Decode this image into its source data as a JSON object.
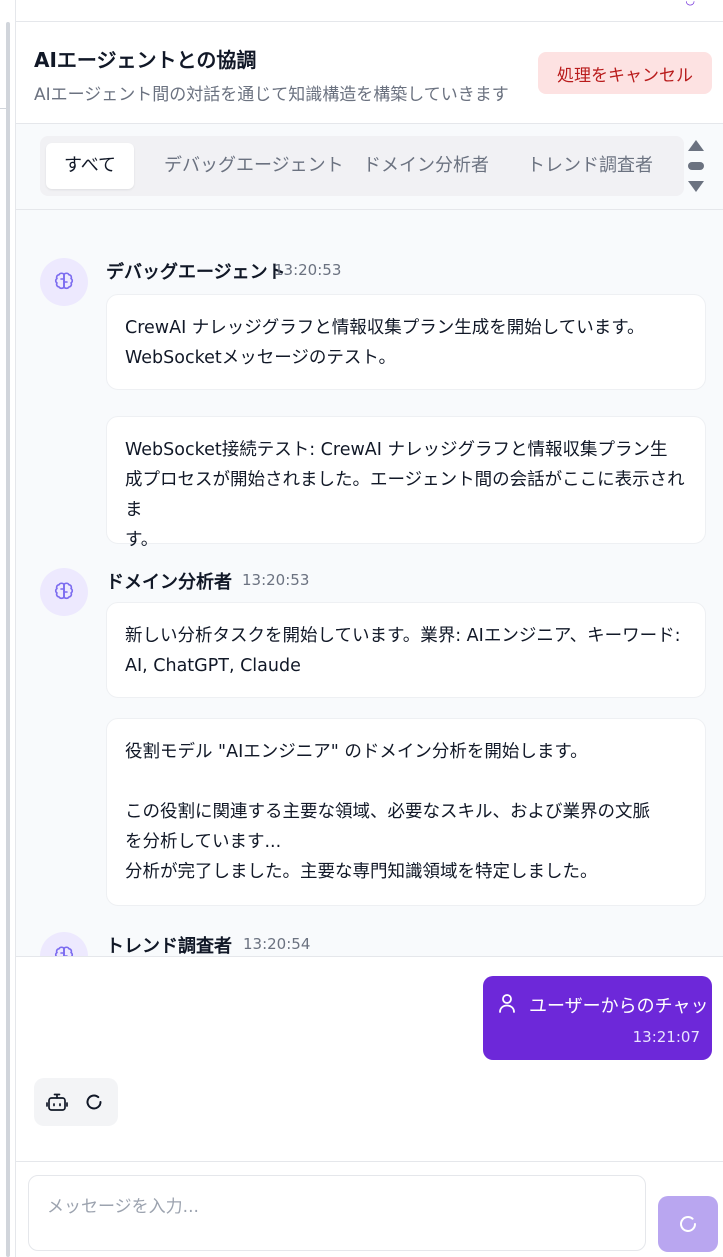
{
  "header": {
    "title": "AIエージェントとの協調",
    "subtitle": "AIエージェント間の対話を通じて知識構造を構築していきます",
    "cancel_label": "処理をキャンセル"
  },
  "tabs": [
    {
      "label": "すべて",
      "active": true
    },
    {
      "label": "デバッグエージェント",
      "active": false
    },
    {
      "label": "ドメイン分析者",
      "active": false
    },
    {
      "label": "トレンド調査者",
      "active": false
    }
  ],
  "feed": {
    "groups": [
      {
        "agent": "デバッグエージェント",
        "time": "13:20:53",
        "icon": "brain-icon",
        "messages": [
          "CrewAI ナレッジグラフと情報収集プラン生成を開始しています。\nWebSocketメッセージのテスト。",
          "WebSocket接続テスト: CrewAI ナレッジグラフと情報収集プラン生\n成プロセスが開始されました。エージェント間の会話がここに表示されま\nす。"
        ]
      },
      {
        "agent": "ドメイン分析者",
        "time": "13:20:53",
        "icon": "brain-icon",
        "messages": [
          "新しい分析タスクを開始しています。業界: AIエンジニア、キーワード:\nAI, ChatGPT, Claude",
          "役割モデル \"AIエンジニア\" のドメイン分析を開始します。\n\nこの役割に関連する主要な領域、必要なスキル、および業界の文脈\nを分析しています...\n分析が完了しました。主要な専門知識領域を特定しました。"
        ]
      },
      {
        "agent": "トレンド調査者",
        "time": "13:20:54",
        "icon": "brain-icon",
        "messages": []
      }
    ]
  },
  "chat": {
    "user_message": "ユーザーからのチャット",
    "user_time": "13:21:07",
    "user_icon": "user-icon",
    "bot_icon": "bot-icon",
    "loading_icon": "spinner-icon"
  },
  "composer": {
    "placeholder": "メッセージを入力...",
    "send_icon": "spinner-icon"
  },
  "colors": {
    "accent": "#6d28d9",
    "accent_light": "#b9a6f0",
    "cancel_bg": "#fde2e2",
    "cancel_text": "#b91c1c",
    "avatar_bg": "#ede9fe"
  }
}
